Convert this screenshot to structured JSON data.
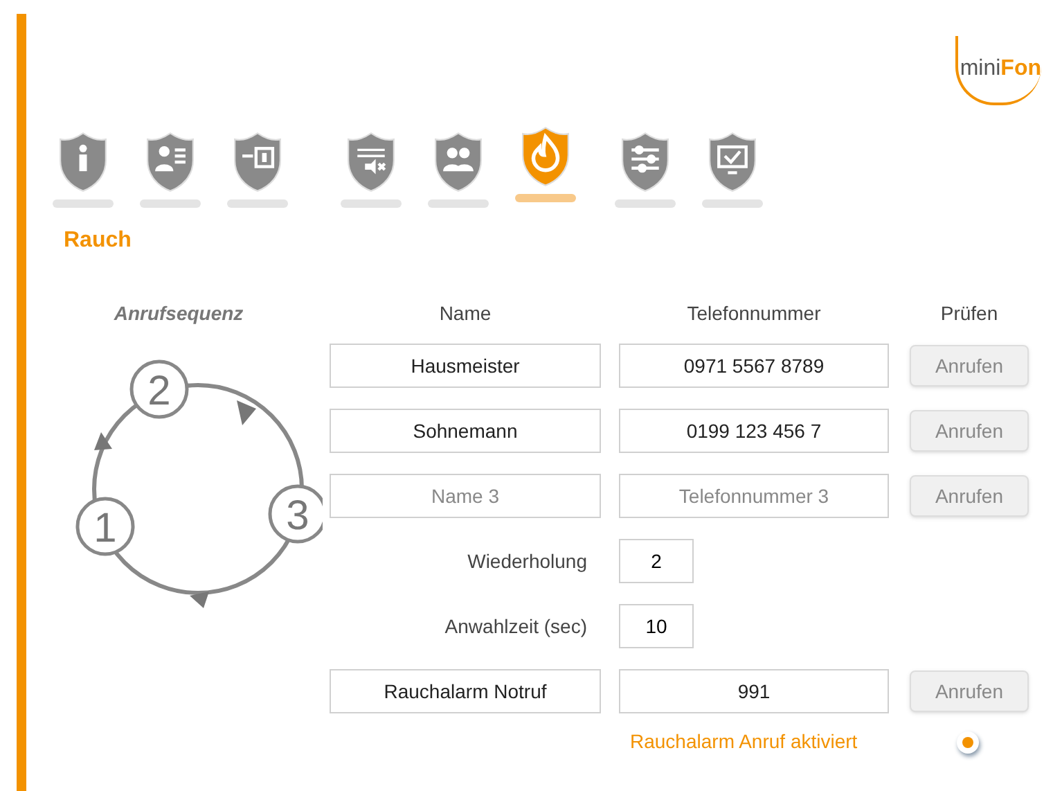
{
  "logo": {
    "small": "mini",
    "bold": "Fon"
  },
  "nav": [
    {
      "selected": false
    },
    {
      "selected": false
    },
    {
      "selected": false
    },
    {
      "selected": false
    },
    {
      "selected": false
    },
    {
      "selected": true
    },
    {
      "selected": false
    },
    {
      "selected": false
    }
  ],
  "title": "Rauch",
  "sequence": {
    "heading": "Anrufsequenz",
    "steps": [
      "1",
      "2",
      "3"
    ]
  },
  "columns": [
    "Name",
    "Telefonnummer",
    "Prüfen"
  ],
  "contacts": [
    {
      "name": {
        "value": "Hausmeister"
      },
      "phone": {
        "value": "0971 5567 8789"
      },
      "button": "Anrufen"
    },
    {
      "name": {
        "value": "Sohnemann"
      },
      "phone": {
        "value": "0199 123 456 7"
      },
      "button": "Anrufen"
    },
    {
      "name": {
        "placeholder": "Name 3"
      },
      "phone": {
        "placeholder": "Telefonnummer 3"
      },
      "button": "Anrufen"
    }
  ],
  "repeat": {
    "label": "Wiederholung",
    "value": "2"
  },
  "dial_time": {
    "label": "Anwahlzeit (sec)",
    "value": "10"
  },
  "emergency": {
    "name": {
      "value": "Rauchalarm Notruf"
    },
    "phone": {
      "value": "991"
    },
    "button": "Anrufen"
  },
  "alarm_call": {
    "label": "Rauchalarm Anruf aktiviert",
    "on": true
  }
}
